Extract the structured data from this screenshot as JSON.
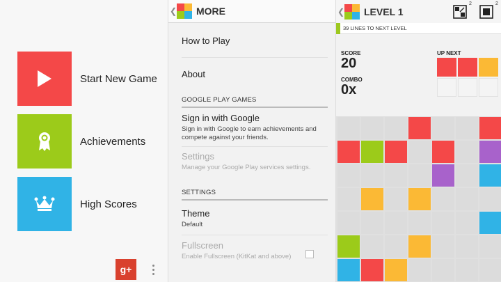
{
  "colors": {
    "red": "#f44848",
    "green": "#9ccb1a",
    "blue": "#30b3e6",
    "orange": "#fbb935",
    "purple": "#a862cb",
    "empty": "#dcdcdc",
    "empty_next": "#f4f4f4"
  },
  "main_menu": {
    "items": [
      {
        "label": "Start New Game",
        "icon": "play-icon",
        "color": "#f44848"
      },
      {
        "label": "Achievements",
        "icon": "ribbon-icon",
        "color": "#9ccb1a"
      },
      {
        "label": "High Scores",
        "icon": "crown-icon",
        "color": "#30b3e6"
      }
    ],
    "google_plus_label": "g+",
    "overflow_icon": "overflow-menu-icon"
  },
  "more_screen": {
    "title": "MORE",
    "how_to_play": "How to Play",
    "about": "About",
    "section_google": "GOOGLE PLAY GAMES",
    "sign_in_title": "Sign in with Google",
    "sign_in_sub": "Sign in with Google to earn achievements and compete against your friends.",
    "gps_settings_title": "Settings",
    "gps_settings_sub": "Manage your Google Play services settings.",
    "section_settings": "SETTINGS",
    "theme_title": "Theme",
    "theme_value": "Default",
    "fullscreen_title": "Fullscreen",
    "fullscreen_sub": "Enable Fullscreen (KitKat and above)",
    "fullscreen_checked": false
  },
  "game_screen": {
    "title": "LEVEL 1",
    "tool1_icon": "shuffle-icon",
    "tool1_count": "2",
    "tool2_icon": "bomb-icon",
    "tool2_count": "2",
    "lines_text": "39 LINES TO NEXT LEVEL",
    "score_label": "SCORE",
    "score_value": "20",
    "combo_label": "COMBO",
    "combo_value": "0x",
    "up_next_label": "UP NEXT",
    "up_next": [
      [
        "red",
        "red",
        "orange"
      ],
      [
        "empty",
        "empty",
        "empty"
      ]
    ],
    "board": [
      [
        "empty",
        "empty",
        "empty",
        "red",
        "empty",
        "empty",
        "red"
      ],
      [
        "red",
        "green",
        "red",
        "empty",
        "red",
        "empty",
        "purple"
      ],
      [
        "empty",
        "empty",
        "empty",
        "empty",
        "purple",
        "empty",
        "blue"
      ],
      [
        "empty",
        "orange",
        "empty",
        "orange",
        "empty",
        "empty",
        "empty"
      ],
      [
        "empty",
        "empty",
        "empty",
        "empty",
        "empty",
        "empty",
        "blue"
      ],
      [
        "green",
        "empty",
        "empty",
        "orange",
        "empty",
        "empty",
        "empty"
      ],
      [
        "blue",
        "red",
        "orange",
        "empty",
        "empty",
        "empty",
        "empty"
      ]
    ]
  }
}
